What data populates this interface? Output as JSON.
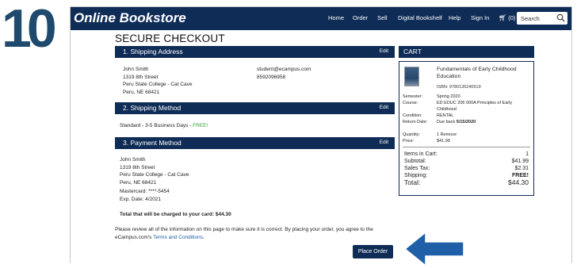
{
  "step_number": "10",
  "header": {
    "logo": "Online Bookstore",
    "nav": [
      "Home",
      "Order",
      "Sell",
      "Digital Bookshelf",
      "Help",
      "Sign In"
    ],
    "cart_count": "(0)",
    "search_placeholder": "Search"
  },
  "page_title": "SECURE CHECKOUT",
  "shipping_address": {
    "heading": "1. Shipping Address",
    "edit": "Edit",
    "lines": [
      "John Smith",
      "1319 8th Street",
      "Peru State College - Cat Cave",
      "Peru, NE 68421"
    ],
    "email": "student@ecampus.com",
    "phone": "8592096958"
  },
  "shipping_method": {
    "heading": "2. Shipping Method",
    "edit": "Edit",
    "text": "Standard - 3-5 Business Days - ",
    "free": "FREE!"
  },
  "payment_method": {
    "heading": "3. Payment Method",
    "edit": "Edit",
    "lines": [
      "John Smith",
      "1319 8th Street",
      "Peru State College - Cat Cave",
      "Peru, NE 68421"
    ],
    "card": "Mastercard: ****-5454",
    "exp": "Exp. Date: 4/2021",
    "charge": "Total that will be charged to your card: $44.30"
  },
  "review_text_1": "Please review all of the information on this page to make sure it is correct. By placing your order, you agree to the",
  "review_text_2": "eCampus.com's ",
  "terms_link": "Terms and Conditions",
  "review_text_3": ".",
  "place_order": "Place Order",
  "cart": {
    "heading": "CART",
    "book_title": "Fundamentals of Early Childhood Education",
    "isbn": "ISBN: 9780135240519",
    "details": [
      {
        "label": "Semester:",
        "value": "Spring 2020"
      },
      {
        "label": "Course:",
        "value": "ED EDUC 206 000A Principles of Early Childhood"
      },
      {
        "label": "Condition:",
        "value": "RENTAL"
      },
      {
        "label": "Return Date:",
        "value": "Due back ",
        "value_bold": "5/15/2020"
      },
      {
        "label": "Quantity:",
        "value": "1 Remove"
      },
      {
        "label": "Price:",
        "value": "$41.99"
      }
    ],
    "totals": [
      {
        "label": "Items in Cart:",
        "value": "1"
      },
      {
        "label": "Subtotal:",
        "value": "$41.99"
      },
      {
        "label": "Sales Tax:",
        "value": "$2.31"
      },
      {
        "label": "Shipping:",
        "value": "FREE!"
      },
      {
        "label": "Total:",
        "value": "$44.30"
      }
    ]
  },
  "colors": {
    "navy": "#0f2c56",
    "free_green": "#3aa63a",
    "link_blue": "#1a5a9e",
    "arrow_blue": "#1f5fa8"
  },
  "icons": [
    "search-icon",
    "cart-icon",
    "pointer-arrow-icon"
  ]
}
